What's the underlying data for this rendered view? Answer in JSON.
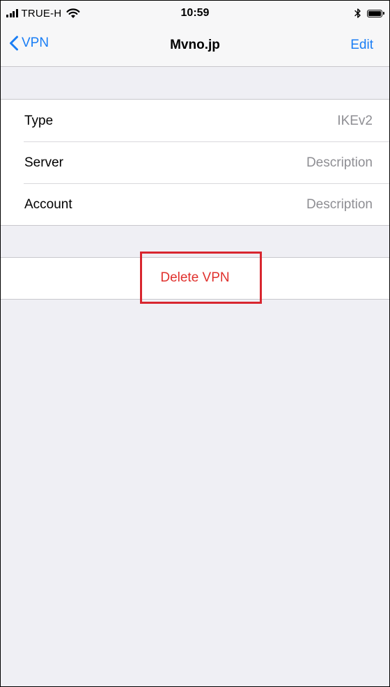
{
  "status_bar": {
    "carrier": "TRUE-H",
    "time": "10:59",
    "signal_bars_filled": 4,
    "battery_level": 1.0,
    "icons": [
      "signal-icon",
      "wifi-icon",
      "bluetooth-icon",
      "battery-icon"
    ]
  },
  "nav": {
    "back_label": "VPN",
    "title": "Mvno.jp",
    "edit_label": "Edit"
  },
  "settings": {
    "rows": [
      {
        "label": "Type",
        "value": "IKEv2"
      },
      {
        "label": "Server",
        "value": "Description"
      },
      {
        "label": "Account",
        "value": "Description"
      }
    ]
  },
  "actions": {
    "delete_label": "Delete VPN"
  },
  "colors": {
    "tint": "#1a7ef5",
    "destructive": "#e0312d",
    "annotation_box": "#d8262f",
    "grouped_background": "#efeff4",
    "secondary_text": "#8e8e93"
  }
}
